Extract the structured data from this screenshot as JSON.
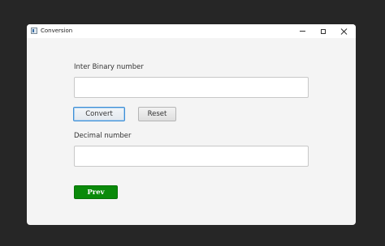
{
  "window": {
    "title": "Conversion"
  },
  "form": {
    "binary_label": "Inter Binary number",
    "binary_value": "",
    "binary_placeholder": "",
    "decimal_label": "Decimal number",
    "decimal_value": "",
    "decimal_placeholder": "",
    "convert_label": "Convert",
    "reset_label": "Reset",
    "prev_label": "Prev"
  },
  "colors": {
    "prev_button": "#0a8a0a",
    "focus_accent": "#3c8ed6",
    "window_bg": "#f4f4f4",
    "desktop_bg": "#262626"
  },
  "icons": {
    "app": "app-window-icon",
    "minimize": "minimize-icon",
    "maximize": "maximize-icon",
    "close": "close-icon"
  }
}
